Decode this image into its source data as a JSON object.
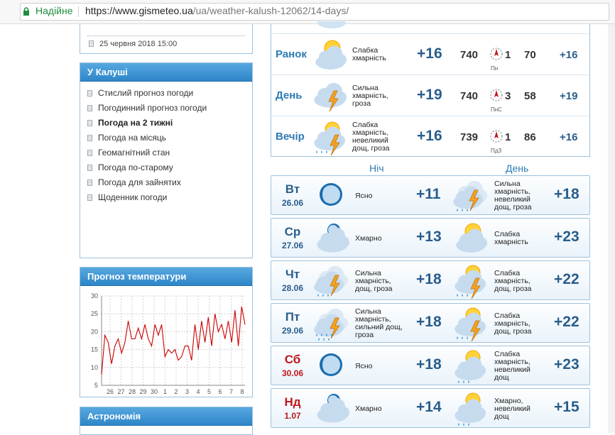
{
  "browser": {
    "secure_label": "Надійне",
    "url_host": "https://www.gismeteo.ua",
    "url_path": "/ua/weather-kalush-12062/14-days/"
  },
  "sidebar": {
    "update_text": "25 червня 2018 15:00",
    "city_title": "У Калуші",
    "menu": [
      {
        "label": "Стислий прогноз погоди"
      },
      {
        "label": "Погодинний прогноз погоди"
      },
      {
        "label": "Погода на 2 тижні",
        "active": true
      },
      {
        "label": "Погода на місяць"
      },
      {
        "label": "Геомагнітний стан"
      },
      {
        "label": "Погода по-старому"
      },
      {
        "label": "Погода для зайнятих"
      },
      {
        "label": "Щоденник погоди"
      }
    ],
    "chart_title": "Прогноз температури",
    "astro_title": "Астрономія"
  },
  "chart_data": {
    "type": "line",
    "title": "Прогноз температури",
    "yticks": [
      5,
      10,
      15,
      20,
      25,
      30
    ],
    "ylim": [
      5,
      30
    ],
    "xticks": [
      "26",
      "27",
      "28",
      "29",
      "30",
      "1",
      "2",
      "3",
      "4",
      "5",
      "6",
      "7",
      "8"
    ],
    "series": [
      {
        "color": "#cc0000",
        "values": [
          8,
          19,
          17,
          11,
          16,
          18,
          14,
          17,
          23,
          18,
          18,
          21,
          18,
          22,
          18,
          16,
          22,
          19,
          22,
          13,
          15,
          14,
          15,
          12,
          13,
          16,
          16,
          12,
          22,
          15,
          23,
          17,
          24,
          16,
          25,
          20,
          22,
          18,
          23,
          17,
          26,
          16,
          27,
          22
        ]
      }
    ],
    "grid": true
  },
  "periods": [
    {
      "name": "Ранок",
      "desc": [
        "Слабка",
        "хмарність"
      ],
      "temp": "+16",
      "pressure": "740",
      "wind_dir": "Пн",
      "wind_speed": "1",
      "humidity": "70",
      "feels": "+16",
      "icon": "partly-cloudy-icon"
    },
    {
      "name": "День",
      "desc": [
        "Сильна",
        "хмарність,",
        "гроза"
      ],
      "temp": "+19",
      "pressure": "740",
      "wind_dir": "ПнС",
      "wind_speed": "3",
      "humidity": "58",
      "feels": "+19",
      "icon": "thunderstorm-icon"
    },
    {
      "name": "Вечір",
      "desc": [
        "Слабка",
        "хмарність,",
        "невеликий",
        "дощ, гроза"
      ],
      "temp": "+16",
      "pressure": "739",
      "wind_dir": "ПдЗ",
      "wind_speed": "1",
      "humidity": "86",
      "feels": "+16",
      "icon": "sun-thunder-rain-icon"
    }
  ],
  "columns": {
    "night": "Ніч",
    "day": "День"
  },
  "days": [
    {
      "name": "Вт",
      "date": "26.06",
      "weekend": false,
      "night": {
        "desc": [
          "Ясно"
        ],
        "temp": "+11",
        "icon": "moon-icon"
      },
      "day": {
        "desc": [
          "Сильна",
          "хмарність,",
          "невеликий",
          "дощ, гроза"
        ],
        "temp": "+18",
        "icon": "cloud-thunder-rain-icon"
      }
    },
    {
      "name": "Ср",
      "date": "27.06",
      "weekend": false,
      "night": {
        "desc": [
          "Хмарно"
        ],
        "temp": "+13",
        "icon": "moon-cloud-icon"
      },
      "day": {
        "desc": [
          "Слабка",
          "хмарність"
        ],
        "temp": "+23",
        "icon": "partly-cloudy-icon"
      }
    },
    {
      "name": "Чт",
      "date": "28.06",
      "weekend": false,
      "night": {
        "desc": [
          "Сильна",
          "хмарність,",
          "дощ, гроза"
        ],
        "temp": "+18",
        "icon": "cloud-thunder-rain-icon"
      },
      "day": {
        "desc": [
          "Слабка",
          "хмарність,",
          "дощ, гроза"
        ],
        "temp": "+22",
        "icon": "sun-thunder-rain-icon"
      }
    },
    {
      "name": "Пт",
      "date": "29.06",
      "weekend": false,
      "night": {
        "desc": [
          "Сильна",
          "хмарність,",
          "сильний дощ,",
          "гроза"
        ],
        "temp": "+18",
        "icon": "cloud-thunder-heavy-rain-icon"
      },
      "day": {
        "desc": [
          "Слабка",
          "хмарність,",
          "дощ, гроза"
        ],
        "temp": "+22",
        "icon": "sun-thunder-rain-icon"
      }
    },
    {
      "name": "Сб",
      "date": "30.06",
      "weekend": true,
      "night": {
        "desc": [
          "Ясно"
        ],
        "temp": "+18",
        "icon": "moon-icon"
      },
      "day": {
        "desc": [
          "Слабка",
          "хмарність,",
          "невеликий",
          "дощ"
        ],
        "temp": "+23",
        "icon": "sun-cloud-rain-icon"
      }
    },
    {
      "name": "Нд",
      "date": "1.07",
      "weekend": true,
      "night": {
        "desc": [
          "Хмарно"
        ],
        "temp": "+14",
        "icon": "moon-cloud-icon"
      },
      "day": {
        "desc": [
          "Хмарно,",
          "невеликий",
          "дощ"
        ],
        "temp": "+15",
        "icon": "sun-cloud-rain-icon"
      }
    }
  ]
}
